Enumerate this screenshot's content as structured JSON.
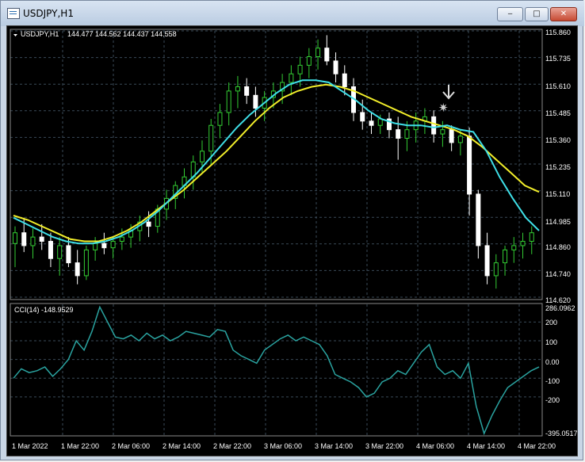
{
  "window": {
    "title": "USDJPY,H1",
    "min_glyph": "‒",
    "max_glyph": "□",
    "close_glyph": "✕"
  },
  "chart_header": {
    "symbol": "USDJPY,H1",
    "ohlc": "144.477 144.562 144.437 144.558"
  },
  "colors": {
    "bg": "#000000",
    "grid": "#3a4a58",
    "bull": "#33cc33",
    "bear": "#ffffff",
    "ma_fast": "#3fe0e8",
    "ma_slow": "#f2ee2a",
    "cci": "#2aa3a0"
  },
  "price_axis": [
    "115.860",
    "115.735",
    "115.610",
    "115.485",
    "115.360",
    "115.235",
    "115.110",
    "114.985",
    "114.860",
    "114.740",
    "114.620"
  ],
  "time_axis": [
    "1 Mar 2022",
    "1 Mar 22:00",
    "2 Mar 06:00",
    "2 Mar 14:00",
    "2 Mar 22:00",
    "3 Mar 06:00",
    "3 Mar 14:00",
    "3 Mar 22:00",
    "4 Mar 06:00",
    "4 Mar 14:00",
    "4 Mar 22:00"
  ],
  "indicator": {
    "label": "CCI(14) -148.9529",
    "axis": [
      "286.0962",
      "200",
      "100",
      "0.00",
      "-100",
      "-200",
      "-395.0517"
    ]
  },
  "chart_data": {
    "type": "candlestick",
    "price_range": [
      114.62,
      115.86
    ],
    "cci_range": [
      -395.0517,
      286.0962
    ],
    "candles": [
      [
        114.87,
        114.95,
        114.76,
        114.92
      ],
      [
        114.92,
        114.99,
        114.83,
        114.86
      ],
      [
        114.86,
        114.94,
        114.8,
        114.9
      ],
      [
        114.9,
        114.96,
        114.84,
        114.88
      ],
      [
        114.88,
        114.92,
        114.76,
        114.8
      ],
      [
        114.8,
        114.9,
        114.72,
        114.86
      ],
      [
        114.86,
        114.9,
        114.76,
        114.78
      ],
      [
        114.78,
        114.84,
        114.68,
        114.72
      ],
      [
        114.72,
        114.86,
        114.7,
        114.84
      ],
      [
        114.84,
        114.9,
        114.79,
        114.87
      ],
      [
        114.87,
        114.92,
        114.82,
        114.85
      ],
      [
        114.85,
        114.9,
        114.8,
        114.88
      ],
      [
        114.88,
        114.94,
        114.84,
        114.9
      ],
      [
        114.9,
        114.96,
        114.85,
        114.93
      ],
      [
        114.93,
        115.0,
        114.88,
        114.97
      ],
      [
        114.97,
        115.02,
        114.9,
        114.95
      ],
      [
        114.95,
        115.05,
        114.92,
        115.03
      ],
      [
        115.03,
        115.12,
        114.98,
        115.08
      ],
      [
        115.08,
        115.16,
        115.03,
        115.14
      ],
      [
        115.14,
        115.22,
        115.08,
        115.18
      ],
      [
        115.18,
        115.28,
        115.12,
        115.25
      ],
      [
        115.25,
        115.35,
        115.2,
        115.3
      ],
      [
        115.3,
        115.45,
        115.24,
        115.42
      ],
      [
        115.42,
        115.52,
        115.36,
        115.48
      ],
      [
        115.48,
        115.62,
        115.42,
        115.58
      ],
      [
        115.58,
        115.65,
        115.5,
        115.6
      ],
      [
        115.6,
        115.64,
        115.52,
        115.56
      ],
      [
        115.56,
        115.6,
        115.46,
        115.5
      ],
      [
        115.5,
        115.58,
        115.44,
        115.55
      ],
      [
        115.55,
        115.62,
        115.5,
        115.58
      ],
      [
        115.58,
        115.66,
        115.52,
        115.62
      ],
      [
        115.62,
        115.7,
        115.56,
        115.66
      ],
      [
        115.66,
        115.74,
        115.6,
        115.7
      ],
      [
        115.7,
        115.78,
        115.64,
        115.74
      ],
      [
        115.74,
        115.82,
        115.68,
        115.78
      ],
      [
        115.78,
        115.84,
        115.7,
        115.72
      ],
      [
        115.72,
        115.76,
        115.62,
        115.66
      ],
      [
        115.66,
        115.7,
        115.56,
        115.6
      ],
      [
        115.6,
        115.64,
        115.44,
        115.48
      ],
      [
        115.48,
        115.54,
        115.4,
        115.44
      ],
      [
        115.44,
        115.48,
        115.38,
        115.42
      ],
      [
        115.42,
        115.47,
        115.38,
        115.45
      ],
      [
        115.45,
        115.48,
        115.36,
        115.4
      ],
      [
        115.4,
        115.46,
        115.26,
        115.36
      ],
      [
        115.36,
        115.44,
        115.3,
        115.4
      ],
      [
        115.4,
        115.48,
        115.34,
        115.44
      ],
      [
        115.44,
        115.5,
        115.38,
        115.46
      ],
      [
        115.46,
        115.49,
        115.34,
        115.38
      ],
      [
        115.38,
        115.44,
        115.32,
        115.4
      ],
      [
        115.4,
        115.42,
        115.3,
        115.34
      ],
      [
        115.34,
        115.4,
        115.28,
        115.37
      ],
      [
        115.37,
        115.41,
        115.0,
        115.1
      ],
      [
        115.1,
        115.12,
        114.8,
        114.86
      ],
      [
        114.86,
        114.92,
        114.68,
        114.72
      ],
      [
        114.72,
        114.82,
        114.66,
        114.78
      ],
      [
        114.78,
        114.86,
        114.72,
        114.84
      ],
      [
        114.84,
        114.9,
        114.78,
        114.86
      ],
      [
        114.86,
        114.92,
        114.8,
        114.88
      ],
      [
        114.88,
        114.95,
        114.82,
        114.92
      ]
    ],
    "ma_fast": [
      114.99,
      114.96,
      114.93,
      114.9,
      114.88,
      114.87,
      114.87,
      114.88,
      114.9,
      114.93,
      114.97,
      115.02,
      115.08,
      115.14,
      115.2,
      115.27,
      115.34,
      115.41,
      115.47,
      115.52,
      115.57,
      115.61,
      115.63,
      115.63,
      115.62,
      115.58,
      115.54,
      115.49,
      115.45,
      115.43,
      115.42,
      115.42,
      115.41,
      115.42,
      115.4,
      115.39,
      115.3,
      115.18,
      115.08,
      114.99,
      114.93
    ],
    "ma_slow": [
      115.0,
      114.98,
      114.95,
      114.92,
      114.89,
      114.88,
      114.88,
      114.9,
      114.93,
      114.97,
      115.02,
      115.07,
      115.12,
      115.18,
      115.24,
      115.3,
      115.37,
      115.44,
      115.5,
      115.55,
      115.58,
      115.6,
      115.61,
      115.6,
      115.58,
      115.55,
      115.52,
      115.49,
      115.46,
      115.44,
      115.42,
      115.4,
      115.37,
      115.32,
      115.26,
      115.2,
      115.14,
      115.11
    ],
    "cci": [
      -100,
      -50,
      -70,
      -60,
      -40,
      -90,
      -50,
      0,
      100,
      50,
      150,
      280,
      200,
      120,
      110,
      130,
      100,
      140,
      110,
      130,
      100,
      120,
      150,
      140,
      130,
      120,
      160,
      150,
      50,
      20,
      0,
      -20,
      50,
      80,
      110,
      130,
      100,
      120,
      100,
      80,
      20,
      -80,
      -100,
      -120,
      -150,
      -200,
      -180,
      -120,
      -100,
      -60,
      -80,
      -20,
      40,
      80,
      -40,
      -80,
      -60,
      -100,
      -20,
      -250,
      -395,
      -300,
      -220,
      -150,
      -120,
      -90,
      -60,
      -40
    ]
  }
}
